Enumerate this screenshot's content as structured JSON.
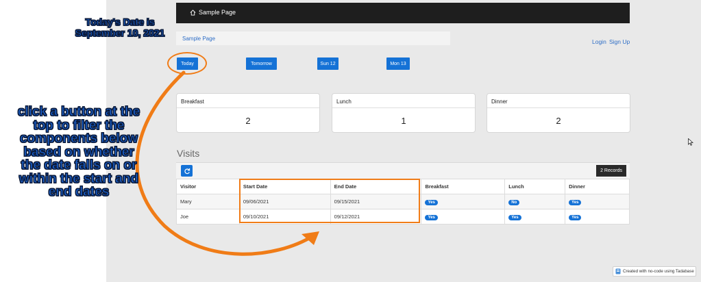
{
  "colors": {
    "accent": "#1572d6",
    "highlight": "#f07c17",
    "topbar": "#1e1e1e"
  },
  "topbar": {
    "brand": "Sample Page",
    "brand_icon": "home-icon"
  },
  "breadcrumb": {
    "label": "Sample Page"
  },
  "auth": {
    "login": "Login",
    "signup": "Sign Up"
  },
  "filters": {
    "today": "Today",
    "tomorrow": "Tomorrow",
    "sun": "Sun 12",
    "mon": "Mon 13"
  },
  "cards": [
    {
      "title": "Breakfast",
      "value": "2"
    },
    {
      "title": "Lunch",
      "value": "1"
    },
    {
      "title": "Dinner",
      "value": "2"
    }
  ],
  "visits": {
    "title": "Visits",
    "records": "2 Records",
    "columns": [
      "Visitor",
      "Start Date",
      "End Date",
      "Breakfast",
      "Lunch",
      "Dinner"
    ],
    "rows": [
      {
        "visitor": "Mary",
        "start": "09/06/2021",
        "end": "09/15/2021",
        "breakfast": "Yes",
        "lunch": "No",
        "dinner": "Yes"
      },
      {
        "visitor": "Joe",
        "start": "09/10/2021",
        "end": "09/12/2021",
        "breakfast": "Yes",
        "lunch": "Yes",
        "dinner": "Yes"
      }
    ]
  },
  "annotations": {
    "date_line1": "Today's Date is",
    "date_line2": "September 10, 2021",
    "instruction_lines": [
      "click a button at the",
      "top to filter the",
      "components below",
      "based on whether",
      "the date falls on or",
      "within the start and",
      "end dates"
    ]
  },
  "footer": {
    "text": "Created with no-code using Tadabase"
  }
}
